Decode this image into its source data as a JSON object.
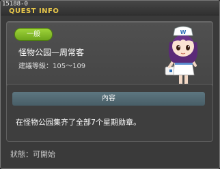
{
  "window": {
    "quest_id": "15188-0",
    "title": "QUEST INFO"
  },
  "quest": {
    "category": "一般",
    "name": "怪物公园—周常客",
    "level_requirement": "建議等級：105～109"
  },
  "details": {
    "section_title": "內容",
    "description": "在怪物公园集齐了全部7个星期勋章。"
  },
  "status": {
    "text": "狀態：可開始"
  },
  "colors": {
    "title_accent": "#e8c74a",
    "category_badge": "#8cc63f",
    "section_header": "#546b75"
  },
  "npc": {
    "icon": "nurse-npc-portrait"
  }
}
